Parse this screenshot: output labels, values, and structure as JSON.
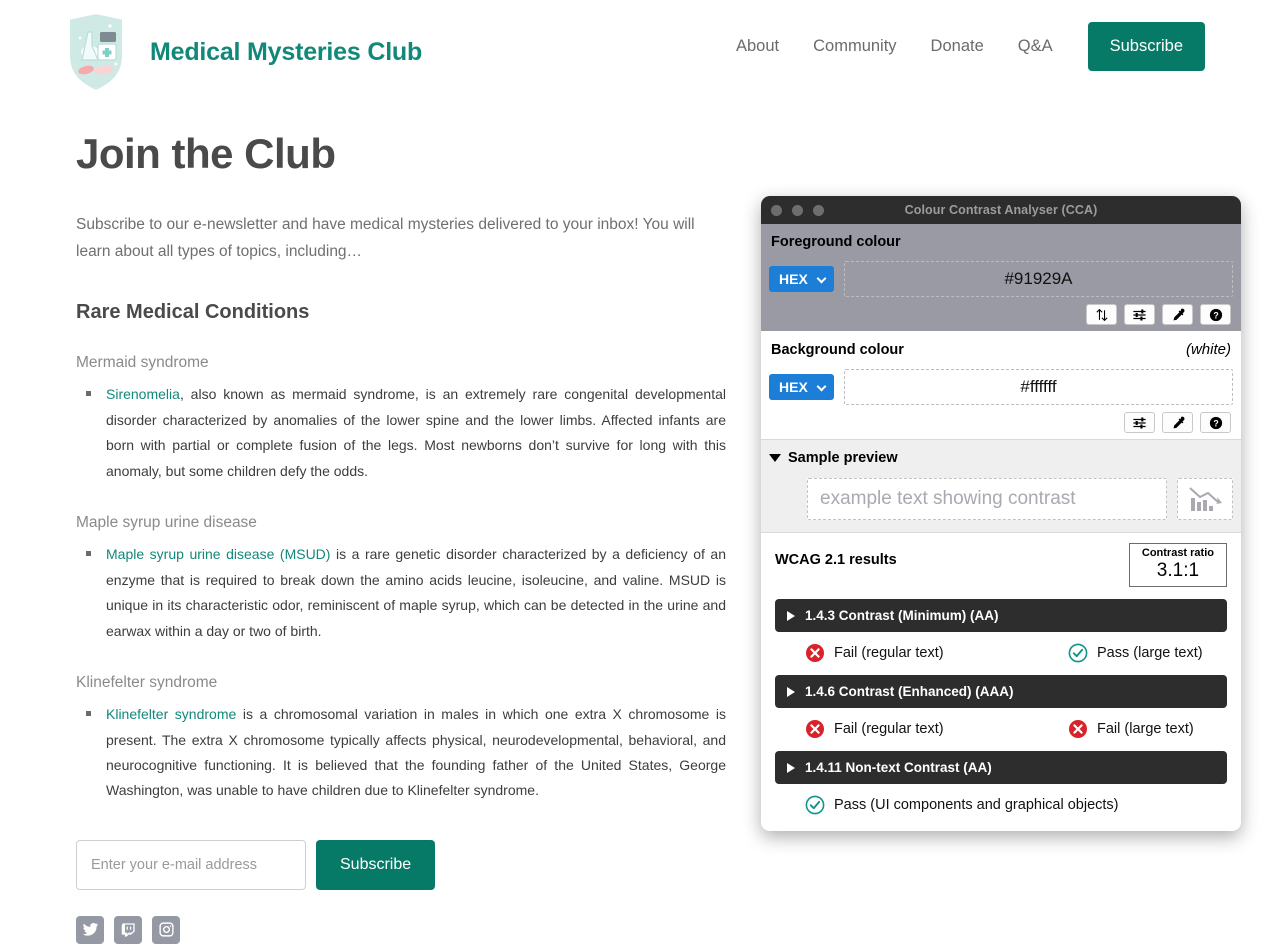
{
  "site": {
    "brand_title": "Medical Mysteries Club",
    "logo_alt": "shield-logo",
    "nav": [
      {
        "label": "About"
      },
      {
        "label": "Community"
      },
      {
        "label": "Donate"
      },
      {
        "label": "Q&A"
      }
    ],
    "nav_cta": "Subscribe",
    "accent_color": "#067a66",
    "brand_color": "#11887a"
  },
  "main": {
    "page_title": "Join the Club",
    "intro": "Subscribe to our e-newsletter and have medical mysteries delivered to your inbox! You will learn about all types of topics, including…",
    "section_title": "Rare Medical Conditions",
    "conditions": [
      {
        "heading": "Mermaid syndrome",
        "link_text": "Sirenomelia",
        "body": ", also known as mermaid syndrome, is an extremely rare congenital developmental disorder characterized by anomalies of the lower spine and the lower limbs. Affected infants are born with partial or complete fusion of the legs. Most newborns don’t survive for long with this anomaly, but some children defy the odds."
      },
      {
        "heading": "Maple syrup urine disease",
        "link_text": "Maple syrup urine disease (MSUD)",
        "body": " is a rare genetic disorder characterized by a deficiency of an enzyme that is required to break down the amino acids leucine, isoleucine, and valine. MSUD is unique in its characteristic odor, reminiscent of maple syrup, which can be detected in the urine and earwax within a day or two of birth."
      },
      {
        "heading": "Klinefelter syndrome",
        "link_text": "Klinefelter syndrome",
        "body": " is a chromosomal variation in males in which one extra X chromosome is present. The extra X chromosome typically affects physical, neurodevelopmental, behavioral, and neurocognitive functioning. It is believed that the founding father of the United States, George Washington, was unable to have children due to Klinefelter syndrome."
      }
    ],
    "form": {
      "email_placeholder": "Enter your e-mail address",
      "email_value": "",
      "submit_label": "Subscribe"
    },
    "socials": [
      {
        "name": "twitter-icon"
      },
      {
        "name": "twitch-icon"
      },
      {
        "name": "instagram-icon"
      }
    ]
  },
  "cca": {
    "window_title": "Colour Contrast Analyser (CCA)",
    "foreground": {
      "label": "Foreground colour",
      "format": "HEX",
      "value": "#91929A",
      "swatch_color": "#91929A",
      "tools": [
        "swap-colours-icon",
        "sliders-icon",
        "eyedropper-icon",
        "help-icon"
      ]
    },
    "background": {
      "label": "Background colour",
      "note": "(white)",
      "format": "HEX",
      "value": "#ffffff",
      "tools": [
        "sliders-icon",
        "eyedropper-icon",
        "help-icon"
      ]
    },
    "preview": {
      "label": "Sample preview",
      "sample_text": "example text showing contrast",
      "graphic_alt": "declining-chart-icon"
    },
    "results": {
      "title": "WCAG 2.1 results",
      "ratio_label": "Contrast ratio",
      "ratio_value": "3.1:1",
      "criteria": [
        {
          "title": "1.4.3 Contrast (Minimum) (AA)",
          "checks": [
            {
              "status": "fail",
              "label": "Fail (regular text)"
            },
            {
              "status": "pass",
              "label": "Pass (large text)"
            }
          ]
        },
        {
          "title": "1.4.6 Contrast (Enhanced) (AAA)",
          "checks": [
            {
              "status": "fail",
              "label": "Fail (regular text)"
            },
            {
              "status": "fail",
              "label": "Fail (large text)"
            }
          ]
        },
        {
          "title": "1.4.11 Non-text Contrast (AA)",
          "checks": [
            {
              "status": "pass",
              "label": "Pass (UI components and graphical objects)"
            }
          ]
        }
      ],
      "pass_color": "#0f9488",
      "fail_color": "#d8232a"
    }
  }
}
